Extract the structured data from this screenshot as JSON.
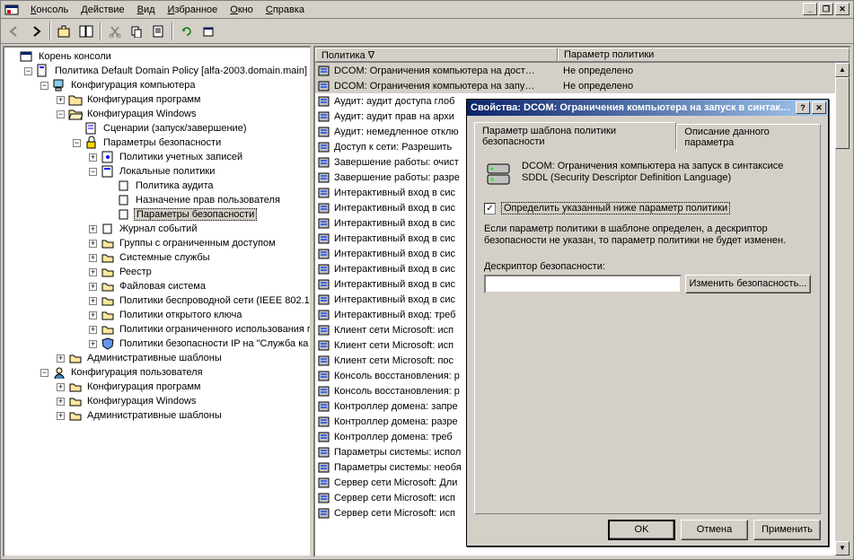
{
  "menu": {
    "console": "Консоль",
    "action": "Действие",
    "view": "Вид",
    "favorites": "Избранное",
    "window": "Окно",
    "help": "Справка"
  },
  "tree": {
    "root": "Корень консоли",
    "policy": "Политика Default Domain Policy [alfa-2003.domain.main]",
    "comp_conf": "Конфигурация компьютера",
    "prog_conf": "Конфигурация программ",
    "win_conf": "Конфигурация Windows",
    "scripts": "Сценарии (запуск/завершение)",
    "sec_params": "Параметры безопасности",
    "account_pol": "Политики учетных записей",
    "local_pol": "Локальные политики",
    "audit_pol": "Политика аудита",
    "user_rights": "Назначение прав пользователя",
    "sec_options": "Параметры безопасности",
    "event_log": "Журнал событий",
    "restricted": "Группы с ограниченным доступом",
    "services": "Системные службы",
    "registry": "Реестр",
    "filesystem": "Файловая система",
    "wireless": "Политики беспроводной сети (IEEE 802.1",
    "pki": "Политики открытого ключа",
    "software_restrict": "Политики ограниченного использования п",
    "ipsec": "Политики безопасности IP на \"Служба ка",
    "admin_templates": "Административные шаблоны",
    "user_conf": "Конфигурация пользователя",
    "prog_conf2": "Конфигурация программ",
    "win_conf2": "Конфигурация Windows",
    "admin_templates2": "Административные шаблоны"
  },
  "list_header": {
    "col1": "Политика  ∇",
    "col2": "Параметр политики"
  },
  "list_rows": [
    {
      "t": "DCOM: Ограничения компьютера на дост…",
      "v": "Не определено",
      "sel": true
    },
    {
      "t": "DCOM: Ограничения компьютера на запу…",
      "v": "Не определено",
      "sel": true
    },
    {
      "t": "Аудит: аудит доступа глоб",
      "v": ""
    },
    {
      "t": "Аудит: аудит прав на архи",
      "v": ""
    },
    {
      "t": "Аудит: немедленное отклю",
      "v": ""
    },
    {
      "t": "Доступ к сети: Разрешить ",
      "v": ""
    },
    {
      "t": "Завершение работы: очист",
      "v": ""
    },
    {
      "t": "Завершение работы: разре",
      "v": ""
    },
    {
      "t": "Интерактивный вход в сис",
      "v": ""
    },
    {
      "t": "Интерактивный вход в сис",
      "v": ""
    },
    {
      "t": "Интерактивный вход в сис",
      "v": ""
    },
    {
      "t": "Интерактивный вход в сис",
      "v": ""
    },
    {
      "t": "Интерактивный вход в сис",
      "v": ""
    },
    {
      "t": "Интерактивный вход в сис",
      "v": ""
    },
    {
      "t": "Интерактивный вход в сис",
      "v": ""
    },
    {
      "t": "Интерактивный вход в сис",
      "v": ""
    },
    {
      "t": "Интерактивный вход: треб",
      "v": ""
    },
    {
      "t": "Клиент сети Microsoft: исп",
      "v": ""
    },
    {
      "t": "Клиент сети Microsoft: исп",
      "v": ""
    },
    {
      "t": "Клиент сети Microsoft: пос",
      "v": ""
    },
    {
      "t": "Консоль восстановления: р",
      "v": ""
    },
    {
      "t": "Консоль восстановления: р",
      "v": ""
    },
    {
      "t": "Контроллер домена: запре",
      "v": ""
    },
    {
      "t": "Контроллер домена: разре",
      "v": ""
    },
    {
      "t": "Контроллер домена: треб",
      "v": ""
    },
    {
      "t": "Параметры системы: испол",
      "v": ""
    },
    {
      "t": "Параметры системы: необя",
      "v": ""
    },
    {
      "t": "Сервер сети Microsoft: Дли",
      "v": ""
    },
    {
      "t": "Сервер сети Microsoft: исп",
      "v": ""
    },
    {
      "t": "Сервер сети Microsoft: исп",
      "v": ""
    }
  ],
  "dialog": {
    "title": "Свойства: DCOM: Ограничения компьютера на запуск в синтак…",
    "tab1": "Параметр шаблона политики безопасности",
    "tab2": "Описание данного параметра",
    "info": "DCOM: Ограничения компьютера на запуск в синтаксисе SDDL (Security Descriptor Definition Language)",
    "checkbox": "Определить указанный ниже параметр политики",
    "note": "Если параметр политики в шаблоне определен, а дескриптор безопасности не указан, то параметр политики не будет изменен.",
    "sd_label": "Дескриптор безопасности:",
    "sd_button": "Изменить безопасность...",
    "ok": "OK",
    "cancel": "Отмена",
    "apply": "Применить"
  }
}
